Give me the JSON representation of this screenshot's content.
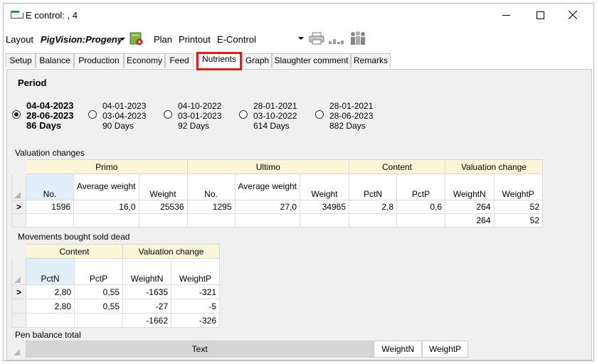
{
  "window": {
    "title": "E control: , 4"
  },
  "toolbar": {
    "layout_label": "Layout",
    "layout_value": "PigVision:Progeny",
    "plan_label": "Plan",
    "printout_label": "Printout",
    "printout_value": "E-Control"
  },
  "tabs": [
    "Setup",
    "Balance",
    "Production",
    "Economy",
    "Feed",
    "Nutrients",
    "Graph",
    "Slaughter comment",
    "Remarks"
  ],
  "active_tab": "Nutrients",
  "period": {
    "title": "Period",
    "options": [
      {
        "from": "04-04-2023",
        "to": "28-06-2023",
        "days": "86 Days",
        "selected": true
      },
      {
        "from": "04-01-2023",
        "to": "03-04-2023",
        "days": "90 Days",
        "selected": false
      },
      {
        "from": "04-10-2022",
        "to": "03-01-2023",
        "days": "92 Days",
        "selected": false
      },
      {
        "from": "28-01-2021",
        "to": "03-10-2022",
        "days": "614 Days",
        "selected": false
      },
      {
        "from": "28-01-2021",
        "to": "28-06-2023",
        "days": "882 Days",
        "selected": false
      }
    ]
  },
  "valuation": {
    "label": "Valuation changes",
    "groups": {
      "primo": "Primo",
      "ultimo": "Ultimo",
      "content": "Content",
      "valuation_change": "Valuation change"
    },
    "columns": [
      "No.",
      "Average weight",
      "Weight",
      "No.",
      "Average weight",
      "Weight",
      "PctN",
      "PctP",
      "WeightN",
      "WeightP"
    ],
    "rows": [
      [
        "1596",
        "16,0",
        "25536",
        "1295",
        "27,0",
        "34965",
        "2,8",
        "0,6",
        "264",
        "52"
      ],
      [
        "",
        "",
        "",
        "",
        "",
        "",
        "",
        "",
        "264",
        "52"
      ]
    ]
  },
  "movements": {
    "label": "Movements bought sold dead",
    "groups": {
      "content": "Content",
      "valuation_change": "Valuation change"
    },
    "columns": [
      "PctN",
      "PctP",
      "WeightN",
      "WeightP"
    ],
    "rows": [
      [
        "2,80",
        "0,55",
        "-1635",
        "-321"
      ],
      [
        "2,80",
        "0,55",
        "-27",
        "-5"
      ],
      [
        "",
        "",
        "-1662",
        "-326"
      ]
    ]
  },
  "pen_balance": {
    "label": "Pen balance total",
    "columns": [
      "Text",
      "WeightN",
      "WeightP"
    ]
  },
  "colors": {
    "group_header": "#fbf6d8",
    "selected_column": "#e3eefb",
    "tab_highlight": "#e01d1d",
    "title_icon": "#1e9e38"
  }
}
